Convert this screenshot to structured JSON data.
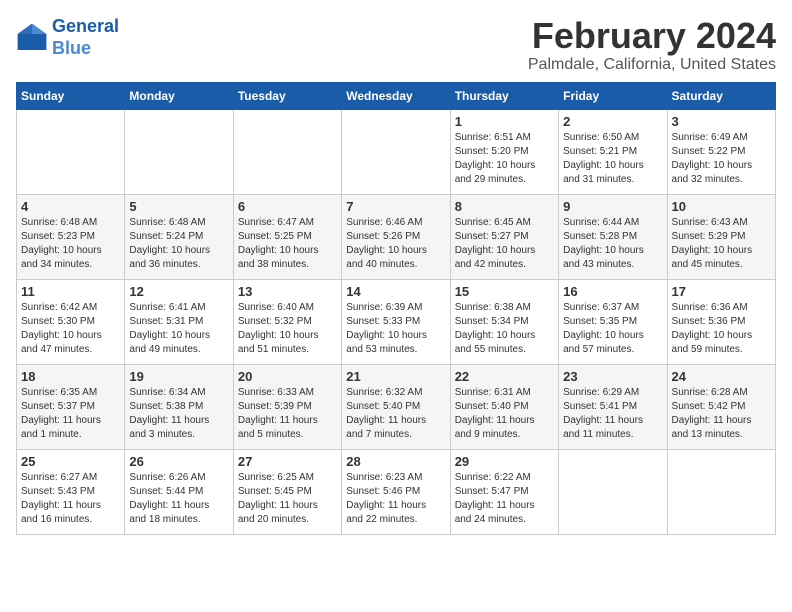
{
  "header": {
    "logo_line1": "General",
    "logo_line2": "Blue",
    "month": "February 2024",
    "location": "Palmdale, California, United States"
  },
  "weekdays": [
    "Sunday",
    "Monday",
    "Tuesday",
    "Wednesday",
    "Thursday",
    "Friday",
    "Saturday"
  ],
  "weeks": [
    [
      {
        "day": "",
        "info": ""
      },
      {
        "day": "",
        "info": ""
      },
      {
        "day": "",
        "info": ""
      },
      {
        "day": "",
        "info": ""
      },
      {
        "day": "1",
        "info": "Sunrise: 6:51 AM\nSunset: 5:20 PM\nDaylight: 10 hours\nand 29 minutes."
      },
      {
        "day": "2",
        "info": "Sunrise: 6:50 AM\nSunset: 5:21 PM\nDaylight: 10 hours\nand 31 minutes."
      },
      {
        "day": "3",
        "info": "Sunrise: 6:49 AM\nSunset: 5:22 PM\nDaylight: 10 hours\nand 32 minutes."
      }
    ],
    [
      {
        "day": "4",
        "info": "Sunrise: 6:48 AM\nSunset: 5:23 PM\nDaylight: 10 hours\nand 34 minutes."
      },
      {
        "day": "5",
        "info": "Sunrise: 6:48 AM\nSunset: 5:24 PM\nDaylight: 10 hours\nand 36 minutes."
      },
      {
        "day": "6",
        "info": "Sunrise: 6:47 AM\nSunset: 5:25 PM\nDaylight: 10 hours\nand 38 minutes."
      },
      {
        "day": "7",
        "info": "Sunrise: 6:46 AM\nSunset: 5:26 PM\nDaylight: 10 hours\nand 40 minutes."
      },
      {
        "day": "8",
        "info": "Sunrise: 6:45 AM\nSunset: 5:27 PM\nDaylight: 10 hours\nand 42 minutes."
      },
      {
        "day": "9",
        "info": "Sunrise: 6:44 AM\nSunset: 5:28 PM\nDaylight: 10 hours\nand 43 minutes."
      },
      {
        "day": "10",
        "info": "Sunrise: 6:43 AM\nSunset: 5:29 PM\nDaylight: 10 hours\nand 45 minutes."
      }
    ],
    [
      {
        "day": "11",
        "info": "Sunrise: 6:42 AM\nSunset: 5:30 PM\nDaylight: 10 hours\nand 47 minutes."
      },
      {
        "day": "12",
        "info": "Sunrise: 6:41 AM\nSunset: 5:31 PM\nDaylight: 10 hours\nand 49 minutes."
      },
      {
        "day": "13",
        "info": "Sunrise: 6:40 AM\nSunset: 5:32 PM\nDaylight: 10 hours\nand 51 minutes."
      },
      {
        "day": "14",
        "info": "Sunrise: 6:39 AM\nSunset: 5:33 PM\nDaylight: 10 hours\nand 53 minutes."
      },
      {
        "day": "15",
        "info": "Sunrise: 6:38 AM\nSunset: 5:34 PM\nDaylight: 10 hours\nand 55 minutes."
      },
      {
        "day": "16",
        "info": "Sunrise: 6:37 AM\nSunset: 5:35 PM\nDaylight: 10 hours\nand 57 minutes."
      },
      {
        "day": "17",
        "info": "Sunrise: 6:36 AM\nSunset: 5:36 PM\nDaylight: 10 hours\nand 59 minutes."
      }
    ],
    [
      {
        "day": "18",
        "info": "Sunrise: 6:35 AM\nSunset: 5:37 PM\nDaylight: 11 hours\nand 1 minute."
      },
      {
        "day": "19",
        "info": "Sunrise: 6:34 AM\nSunset: 5:38 PM\nDaylight: 11 hours\nand 3 minutes."
      },
      {
        "day": "20",
        "info": "Sunrise: 6:33 AM\nSunset: 5:39 PM\nDaylight: 11 hours\nand 5 minutes."
      },
      {
        "day": "21",
        "info": "Sunrise: 6:32 AM\nSunset: 5:40 PM\nDaylight: 11 hours\nand 7 minutes."
      },
      {
        "day": "22",
        "info": "Sunrise: 6:31 AM\nSunset: 5:40 PM\nDaylight: 11 hours\nand 9 minutes."
      },
      {
        "day": "23",
        "info": "Sunrise: 6:29 AM\nSunset: 5:41 PM\nDaylight: 11 hours\nand 11 minutes."
      },
      {
        "day": "24",
        "info": "Sunrise: 6:28 AM\nSunset: 5:42 PM\nDaylight: 11 hours\nand 13 minutes."
      }
    ],
    [
      {
        "day": "25",
        "info": "Sunrise: 6:27 AM\nSunset: 5:43 PM\nDaylight: 11 hours\nand 16 minutes."
      },
      {
        "day": "26",
        "info": "Sunrise: 6:26 AM\nSunset: 5:44 PM\nDaylight: 11 hours\nand 18 minutes."
      },
      {
        "day": "27",
        "info": "Sunrise: 6:25 AM\nSunset: 5:45 PM\nDaylight: 11 hours\nand 20 minutes."
      },
      {
        "day": "28",
        "info": "Sunrise: 6:23 AM\nSunset: 5:46 PM\nDaylight: 11 hours\nand 22 minutes."
      },
      {
        "day": "29",
        "info": "Sunrise: 6:22 AM\nSunset: 5:47 PM\nDaylight: 11 hours\nand 24 minutes."
      },
      {
        "day": "",
        "info": ""
      },
      {
        "day": "",
        "info": ""
      }
    ]
  ]
}
